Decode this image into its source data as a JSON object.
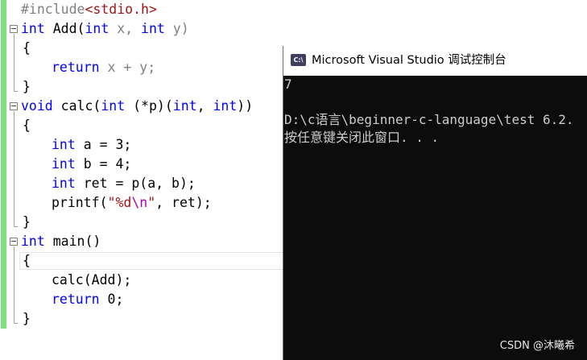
{
  "editor": {
    "lines": [
      {
        "segments": [
          {
            "t": "#include",
            "c": "inc"
          },
          {
            "t": "<stdio.h>",
            "c": "hdr"
          }
        ]
      },
      {
        "segments": [
          {
            "t": "int",
            "c": "kw"
          },
          {
            "t": " Add(",
            "c": "tx"
          },
          {
            "t": "int",
            "c": "kw"
          },
          {
            "t": " x, ",
            "c": "par"
          },
          {
            "t": "int",
            "c": "kw"
          },
          {
            "t": " y)",
            "c": "par"
          }
        ]
      },
      {
        "segments": [
          {
            "t": "{",
            "c": "tx"
          }
        ]
      },
      {
        "segments": [
          {
            "t": "return",
            "c": "kw"
          },
          {
            "t": " x + y;",
            "c": "par"
          }
        ]
      },
      {
        "segments": [
          {
            "t": "}",
            "c": "tx"
          }
        ]
      },
      {
        "segments": [
          {
            "t": "void",
            "c": "kw"
          },
          {
            "t": " calc(",
            "c": "tx"
          },
          {
            "t": "int",
            "c": "kw"
          },
          {
            "t": " (*p)(",
            "c": "tx"
          },
          {
            "t": "int",
            "c": "kw"
          },
          {
            "t": ", ",
            "c": "tx"
          },
          {
            "t": "int",
            "c": "kw"
          },
          {
            "t": "))",
            "c": "tx"
          }
        ]
      },
      {
        "segments": [
          {
            "t": "{",
            "c": "tx"
          }
        ]
      },
      {
        "segments": [
          {
            "t": "int",
            "c": "kw"
          },
          {
            "t": " a = 3;",
            "c": "tx"
          }
        ]
      },
      {
        "segments": [
          {
            "t": "int",
            "c": "kw"
          },
          {
            "t": " b = 4;",
            "c": "tx"
          }
        ]
      },
      {
        "segments": [
          {
            "t": "int",
            "c": "kw"
          },
          {
            "t": " ret = p(a, b);",
            "c": "tx"
          }
        ]
      },
      {
        "segments": [
          {
            "t": "printf(",
            "c": "tx"
          },
          {
            "t": "\"%d",
            "c": "str"
          },
          {
            "t": "\\n",
            "c": "esc"
          },
          {
            "t": "\"",
            "c": "str"
          },
          {
            "t": ", ret);",
            "c": "tx"
          }
        ]
      },
      {
        "segments": [
          {
            "t": "}",
            "c": "tx"
          }
        ]
      },
      {
        "segments": [
          {
            "t": "int",
            "c": "kw"
          },
          {
            "t": " main()",
            "c": "tx"
          }
        ]
      },
      {
        "segments": [
          {
            "t": "{",
            "c": "tx"
          }
        ]
      },
      {
        "segments": [
          {
            "t": "calc(Add);",
            "c": "tx"
          }
        ]
      },
      {
        "segments": [
          {
            "t": "return",
            "c": "kw"
          },
          {
            "t": " 0;",
            "c": "tx"
          }
        ]
      },
      {
        "segments": [
          {
            "t": "}",
            "c": "tx"
          }
        ]
      }
    ]
  },
  "console": {
    "icon_text": "C:\\",
    "icon": "console-app-icon",
    "title": "Microsoft Visual Studio 调试控制台",
    "output": [
      "7",
      "",
      "D:\\c语言\\beginner-c-language\\test 6.2.",
      "按任意键关闭此窗口. . ."
    ]
  },
  "watermark": "CSDN @沐曦希",
  "colors": {
    "keyword": "#0000ff",
    "string": "#a31515",
    "escape": "#b000b0",
    "change_bar": "#7fe07f",
    "console_bg": "#0c0c0c",
    "console_text": "#cccccc"
  }
}
